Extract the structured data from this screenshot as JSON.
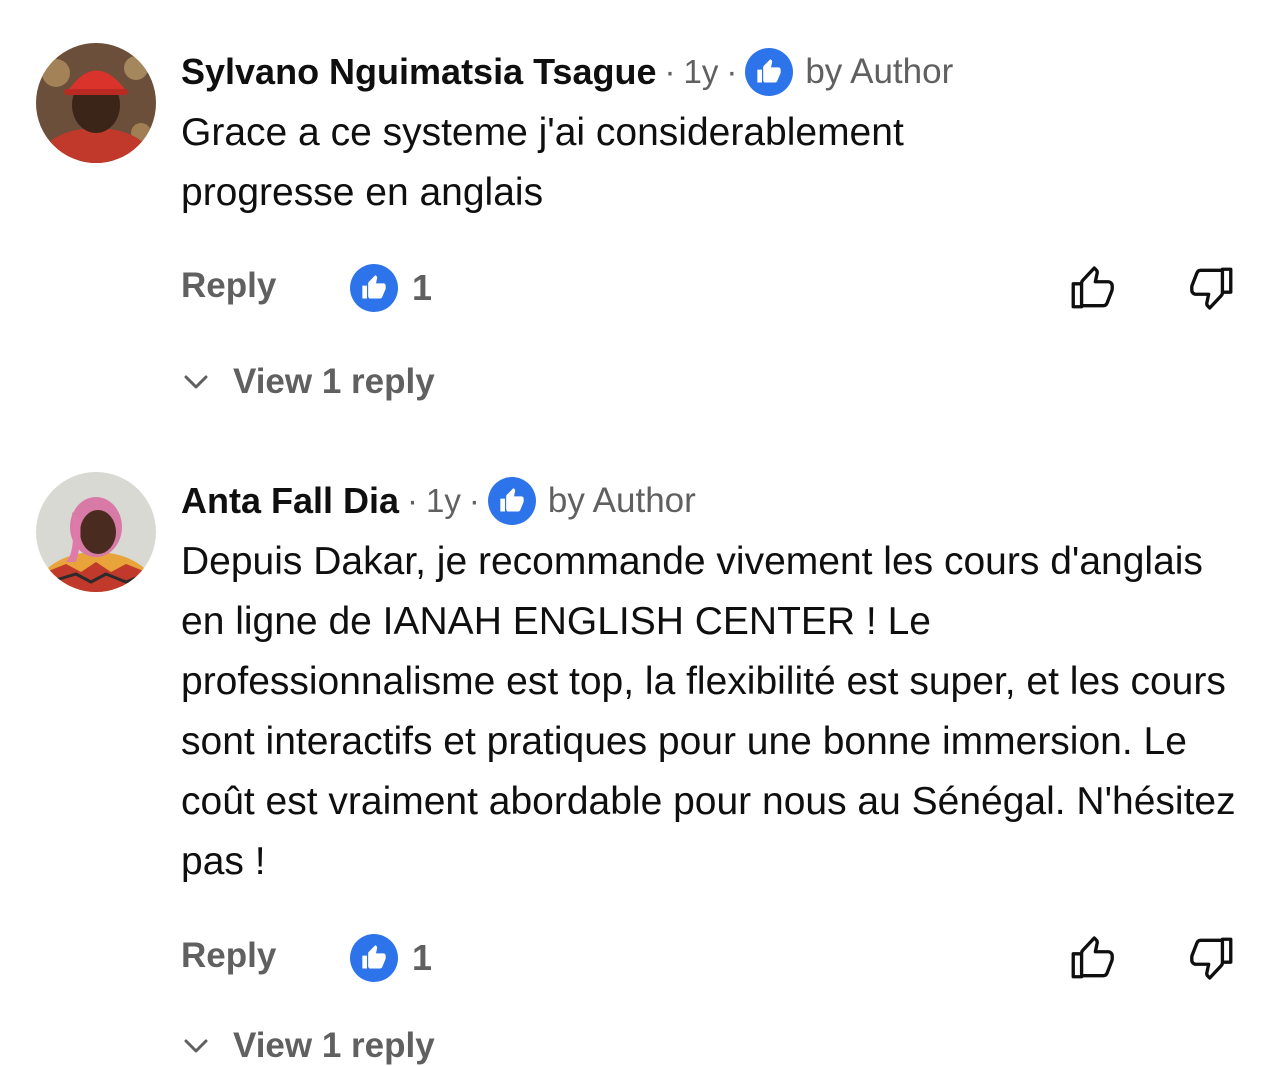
{
  "comments": [
    {
      "author": "Sylvano Nguimatsia Tsague",
      "time": "1y",
      "separator": "·",
      "liked_by_author": "by Author",
      "text": "Grace a ce systeme j'ai considerablement progresse en anglais",
      "reply_label": "Reply",
      "like_count": "1",
      "view_replies": "View 1 reply"
    },
    {
      "author": "Anta Fall Dia",
      "time": "1y",
      "separator": "·",
      "liked_by_author": "by Author",
      "text": "Depuis Dakar, je recommande vivement les cours d'anglais en ligne de IANAH ENGLISH CENTER ! Le professionnalisme est top, la flexibilité est super, et les cours sont interactifs et pratiques pour une bonne immersion. Le coût est vraiment abordable pour nous au Sénégal. N'hésitez pas !",
      "reply_label": "Reply",
      "like_count": "1",
      "view_replies": "View 1 reply"
    }
  ],
  "colors": {
    "accent": "#2d74ea",
    "secondary_text": "#606060",
    "primary_text": "#0f0f0f"
  },
  "icons": {
    "author_like": "thumbs-up-icon",
    "like": "thumbs-up-outline-icon",
    "dislike": "thumbs-down-outline-icon",
    "expand": "chevron-down-icon"
  }
}
